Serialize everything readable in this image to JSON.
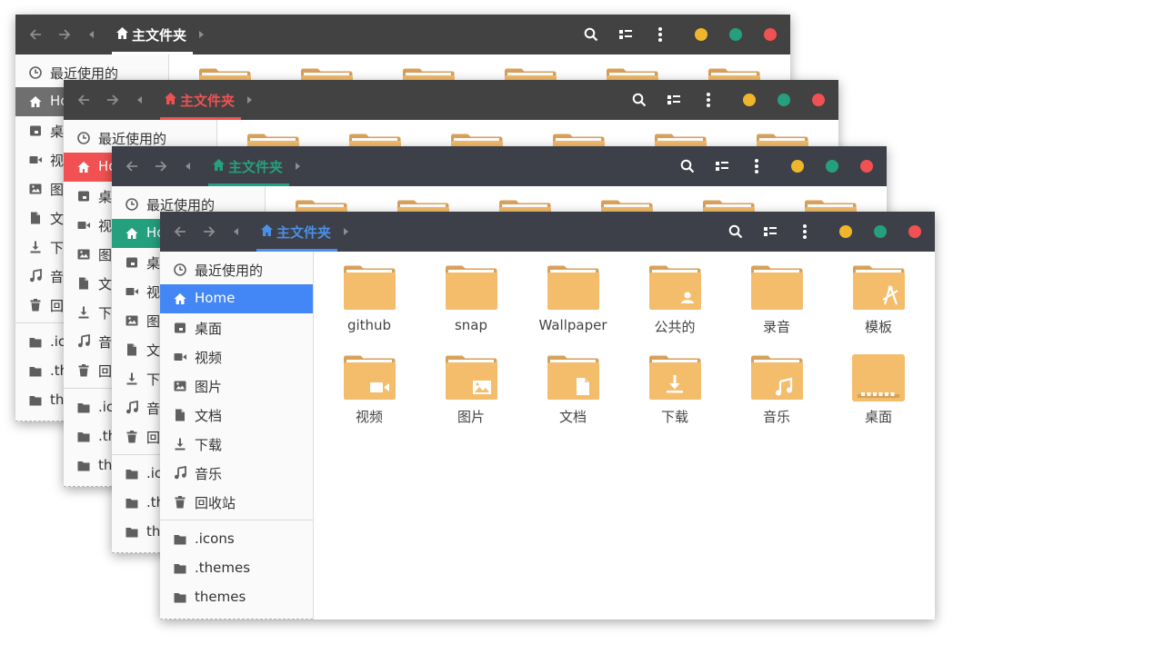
{
  "windows": [
    {
      "id": "win1",
      "colors": {
        "titlebar": "#424242",
        "accent": "#ffffff",
        "underline": "#ffffff",
        "sidebar_active": "#6f6f6f"
      },
      "path_label": "主文件夹",
      "sidebar": {
        "items": [
          {
            "label": "最近使用的",
            "icon": "clock-icon"
          },
          {
            "label": "Home",
            "icon": "home-icon",
            "active": true
          },
          {
            "label": "桌面",
            "icon": "desktop-icon"
          },
          {
            "label": "视频",
            "icon": "video-icon"
          },
          {
            "label": "图片",
            "icon": "image-icon"
          },
          {
            "label": "文档",
            "icon": "document-icon"
          },
          {
            "label": "下载",
            "icon": "download-icon"
          },
          {
            "label": "音乐",
            "icon": "music-icon"
          },
          {
            "label": "回收站",
            "icon": "trash-icon"
          }
        ],
        "bookmarks": [
          {
            "label": ".icons",
            "icon": "folder-icon"
          },
          {
            "label": ".themes",
            "icon": "folder-icon"
          },
          {
            "label": "themes",
            "icon": "folder-icon"
          }
        ]
      }
    },
    {
      "id": "win2",
      "colors": {
        "titlebar": "#424242",
        "accent": "#f15152",
        "underline": "#f15152",
        "sidebar_active": "#f15152"
      },
      "path_label": "主文件夹",
      "sidebar": {
        "items": [
          {
            "label": "最近使用的",
            "icon": "clock-icon"
          },
          {
            "label": "Home",
            "icon": "home-icon",
            "active": true
          },
          {
            "label": "桌面",
            "icon": "desktop-icon"
          },
          {
            "label": "视频",
            "icon": "video-icon"
          },
          {
            "label": "图片",
            "icon": "image-icon"
          },
          {
            "label": "文档",
            "icon": "document-icon"
          },
          {
            "label": "下载",
            "icon": "download-icon"
          },
          {
            "label": "音乐",
            "icon": "music-icon"
          },
          {
            "label": "回收站",
            "icon": "trash-icon"
          }
        ],
        "bookmarks": [
          {
            "label": ".icons",
            "icon": "folder-icon"
          },
          {
            "label": ".themes",
            "icon": "folder-icon"
          },
          {
            "label": "themes",
            "icon": "folder-icon"
          }
        ]
      }
    },
    {
      "id": "win3",
      "colors": {
        "titlebar": "#3d4048",
        "accent": "#25a07f",
        "underline": "#25a07f",
        "sidebar_active": "#25a07f"
      },
      "path_label": "主文件夹",
      "sidebar": {
        "items": [
          {
            "label": "最近使用的",
            "icon": "clock-icon"
          },
          {
            "label": "Home",
            "icon": "home-icon",
            "active": true
          },
          {
            "label": "桌面",
            "icon": "desktop-icon"
          },
          {
            "label": "视频",
            "icon": "video-icon"
          },
          {
            "label": "图片",
            "icon": "image-icon"
          },
          {
            "label": "文档",
            "icon": "document-icon"
          },
          {
            "label": "下载",
            "icon": "download-icon"
          },
          {
            "label": "音乐",
            "icon": "music-icon"
          },
          {
            "label": "回收站",
            "icon": "trash-icon"
          }
        ],
        "bookmarks": [
          {
            "label": ".icons",
            "icon": "folder-icon"
          },
          {
            "label": ".themes",
            "icon": "folder-icon"
          },
          {
            "label": "themes",
            "icon": "folder-icon"
          }
        ]
      }
    },
    {
      "id": "win4",
      "colors": {
        "titlebar": "#3d4048",
        "accent": "#4a90e8",
        "underline": "#4a90e8",
        "sidebar_active": "#4287f5"
      },
      "path_label": "主文件夹",
      "sidebar": {
        "items": [
          {
            "label": "最近使用的",
            "icon": "clock-icon"
          },
          {
            "label": "Home",
            "icon": "home-icon",
            "active": true
          },
          {
            "label": "桌面",
            "icon": "desktop-icon"
          },
          {
            "label": "视频",
            "icon": "video-icon"
          },
          {
            "label": "图片",
            "icon": "image-icon"
          },
          {
            "label": "文档",
            "icon": "document-icon"
          },
          {
            "label": "下载",
            "icon": "download-icon"
          },
          {
            "label": "音乐",
            "icon": "music-icon"
          },
          {
            "label": "回收站",
            "icon": "trash-icon"
          }
        ],
        "bookmarks": [
          {
            "label": ".icons",
            "icon": "folder-icon"
          },
          {
            "label": ".themes",
            "icon": "folder-icon"
          },
          {
            "label": "themes",
            "icon": "folder-icon"
          }
        ]
      }
    }
  ],
  "files": [
    {
      "label": "github",
      "icon": "folder-icon"
    },
    {
      "label": "snap",
      "icon": "folder-icon"
    },
    {
      "label": "Wallpaper",
      "icon": "folder-icon"
    },
    {
      "label": "公共的",
      "icon": "folder-public-icon"
    },
    {
      "label": "录音",
      "icon": "folder-icon"
    },
    {
      "label": "模板",
      "icon": "folder-templates-icon"
    },
    {
      "label": "视频",
      "icon": "folder-videos-icon"
    },
    {
      "label": "图片",
      "icon": "folder-pictures-icon"
    },
    {
      "label": "文档",
      "icon": "folder-documents-icon"
    },
    {
      "label": "下载",
      "icon": "folder-download-icon"
    },
    {
      "label": "音乐",
      "icon": "folder-music-icon"
    },
    {
      "label": "桌面",
      "icon": "folder-desktop-icon"
    }
  ],
  "folder_colors": {
    "body": "#f4bd6c",
    "back": "#d9a05a",
    "paper": "#ffffff",
    "emblem": "#ffffff"
  }
}
